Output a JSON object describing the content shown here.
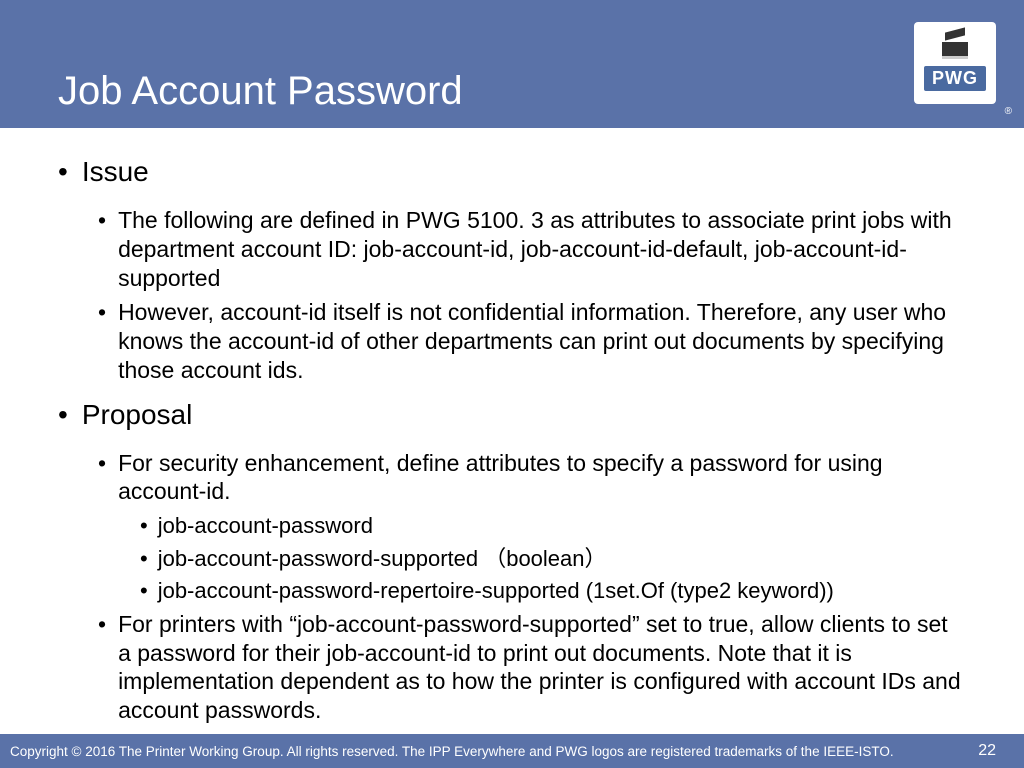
{
  "header": {
    "title": "Job Account Password",
    "logo_text": "PWG",
    "reg": "®"
  },
  "sections": {
    "issue": {
      "heading": "Issue",
      "b1": "The following are defined in PWG 5100. 3 as attributes to associate print jobs with department account ID: job-account-id, job-account-id-default, job-account-id-supported",
      "b2": "However, account-id itself is not confidential information. Therefore, any user who knows the account-id of other departments can print out documents by specifying those account ids."
    },
    "proposal": {
      "heading": "Proposal",
      "b1": "For security enhancement, define attributes to specify a password for using account-id.",
      "s1": "job-account-password",
      "s2": "job-account-password-supported （boolean）",
      "s3": "job-account-password-repertoire-supported (1set.Of (type2 keyword))",
      "b2": "For printers with “job-account-password-supported” set to true, allow clients to set a password for their job-account-id to print out documents. Note that it is implementation dependent as to how the printer is configured with account IDs and account passwords."
    }
  },
  "footer": {
    "copyright": "Copyright © 2016 The Printer Working Group. All rights reserved. The IPP Everywhere and PWG logos are registered trademarks of the IEEE-ISTO.",
    "page": "22"
  }
}
